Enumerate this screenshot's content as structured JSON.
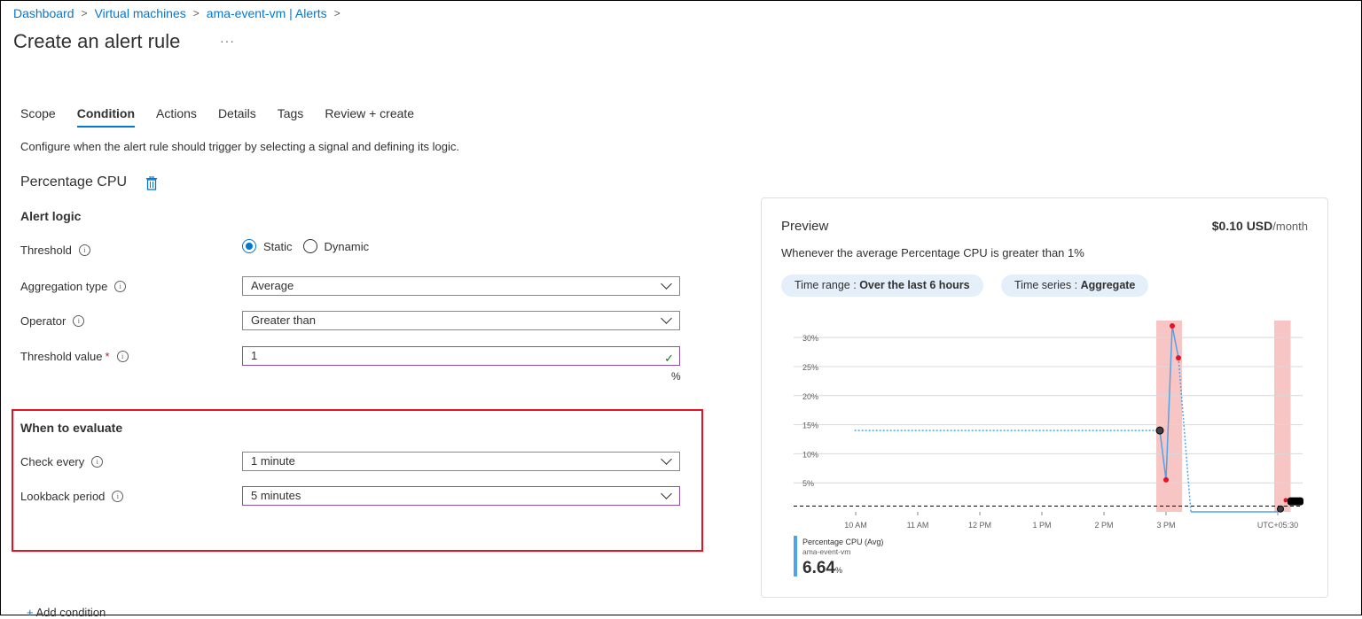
{
  "breadcrumb": [
    "Dashboard",
    "Virtual machines",
    "ama-event-vm | Alerts"
  ],
  "page_title": "Create an alert rule",
  "more_label": "···",
  "tabs": [
    {
      "label": "Scope",
      "active": false
    },
    {
      "label": "Condition",
      "active": true
    },
    {
      "label": "Actions",
      "active": false
    },
    {
      "label": "Details",
      "active": false
    },
    {
      "label": "Tags",
      "active": false
    },
    {
      "label": "Review + create",
      "active": false
    }
  ],
  "description": "Configure when the alert rule should trigger by selecting a signal and defining its logic.",
  "signal_name": "Percentage CPU",
  "alert_logic": {
    "heading": "Alert logic",
    "threshold_label": "Threshold",
    "threshold_options": [
      "Static",
      "Dynamic"
    ],
    "threshold_selected": "Static",
    "aggregation_label": "Aggregation type",
    "aggregation_value": "Average",
    "operator_label": "Operator",
    "operator_value": "Greater than",
    "threshold_value_label": "Threshold value",
    "threshold_value": "1",
    "threshold_unit": "%"
  },
  "evaluate": {
    "heading": "When to evaluate",
    "check_every_label": "Check every",
    "check_every_value": "1 minute",
    "lookback_label": "Lookback period",
    "lookback_value": "5 minutes"
  },
  "add_condition_label": "Add condition",
  "preview": {
    "title": "Preview",
    "cost": "$0.10 USD",
    "cost_unit": "/month",
    "description": "Whenever the average Percentage CPU is greater than 1%",
    "time_range_label": "Time range :",
    "time_range_value": "Over the last 6 hours",
    "time_series_label": "Time series :",
    "time_series_value": "Aggregate",
    "legend_name": "Percentage CPU (Avg)",
    "legend_sub": "ama-event-vm",
    "legend_value": "6.64",
    "legend_unit": "%"
  },
  "chart_data": {
    "type": "line",
    "y_ticks": [
      "30%",
      "25%",
      "20%",
      "15%",
      "10%",
      "5%"
    ],
    "x_ticks": [
      "10 AM",
      "11 AM",
      "12 PM",
      "1 PM",
      "2 PM",
      "3 PM",
      "UTC+05:30"
    ],
    "ylim": [
      0,
      32
    ],
    "threshold": 1,
    "series": [
      {
        "x": [
          9.98,
          14.9,
          15.0,
          15.1,
          15.2,
          15.4,
          16.8,
          16.9
        ],
        "y": [
          14,
          14,
          5.5,
          32,
          26.5,
          0,
          0,
          1
        ]
      }
    ],
    "grid": true,
    "colors": {
      "line": "#4fa3e8",
      "alert_band": "#f8c5c5",
      "breach_point": "#e81123"
    }
  }
}
